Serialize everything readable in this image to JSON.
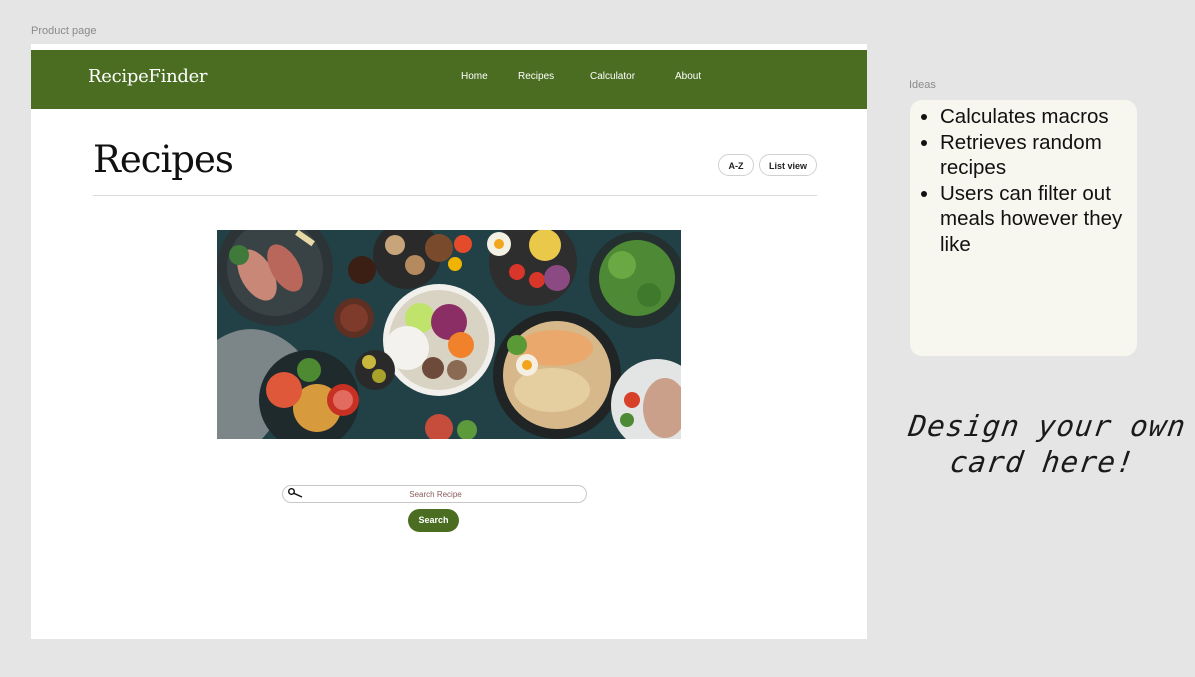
{
  "canvas": {
    "frame_label": "Product page",
    "ideas_label": "Ideas"
  },
  "navbar": {
    "logo": "RecipeFinder",
    "links": [
      "Home",
      "Recipes",
      "Calculator",
      "About"
    ],
    "background": "#4a6d21"
  },
  "main": {
    "title": "Recipes",
    "sort_button": "A-Z",
    "view_button": "List view"
  },
  "search": {
    "placeholder": "Search Recipe",
    "button": "Search"
  },
  "ideas": {
    "items": [
      "Calculates macros",
      "Retrieves random recipes",
      "Users can filter out meals however they like"
    ]
  },
  "note": {
    "line1": "Design your own",
    "line2": "card here!"
  }
}
